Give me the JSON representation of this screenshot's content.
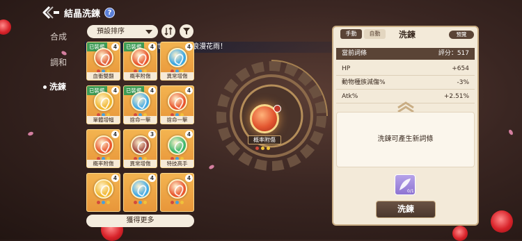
{
  "header": {
    "title": "結晶洗鍊",
    "help_label": "?"
  },
  "nav": {
    "items": [
      {
        "label": "合成"
      },
      {
        "label": "調和"
      },
      {
        "label": "洗鍊"
      }
    ]
  },
  "sort": {
    "selected": "預設排序"
  },
  "announcement": "世界下起了浪漫花雨！",
  "cards": [
    {
      "label": "血衝雙翻",
      "count": "4",
      "badge": "已裝備",
      "color": "#e0582f"
    },
    {
      "label": "概率附傷",
      "count": "4",
      "badge": "已裝備",
      "color": "#e8552d"
    },
    {
      "label": "異常增傷",
      "count": "4",
      "badge": "",
      "color": "#3aa5e0"
    },
    {
      "label": "單體增幅",
      "count": "4",
      "badge": "已裝備",
      "color": "#f0b52e"
    },
    {
      "label": "捨命一擊",
      "count": "4",
      "badge": "已裝備",
      "color": "#44a9e3"
    },
    {
      "label": "捨命一擊",
      "count": "4",
      "badge": "",
      "color": "#e8552d"
    },
    {
      "label": "概率附傷",
      "count": "4",
      "badge": "",
      "color": "#e8552d"
    },
    {
      "label": "異常增傷",
      "count": "3",
      "badge": "",
      "color": "#a0443a"
    },
    {
      "label": "特技高手",
      "count": "4",
      "badge": "",
      "color": "#3db66a"
    },
    {
      "label": "",
      "count": "4",
      "badge": "",
      "color": "#f0b52e"
    },
    {
      "label": "",
      "count": "4",
      "badge": "",
      "color": "#44a9e3"
    },
    {
      "label": "",
      "count": "4",
      "badge": "",
      "color": "#e8552d"
    }
  ],
  "more_label": "獲得更多",
  "center": {
    "label": "概率附傷"
  },
  "panel": {
    "tabs": [
      {
        "label": "手動"
      },
      {
        "label": "自動"
      }
    ],
    "title": "洗鍊",
    "preview_label": "預覽",
    "current_label": "當前詞條",
    "score_label": "評分：517",
    "stats": [
      {
        "name": "HP",
        "value": "+654"
      },
      {
        "name": "動物種族減傷%",
        "value": "-3%"
      },
      {
        "name": "Atk%",
        "value": "+2.51%"
      }
    ],
    "description": "洗鍊可產生新詞條",
    "material_count": "0/1",
    "refine_label": "洗鍊"
  }
}
